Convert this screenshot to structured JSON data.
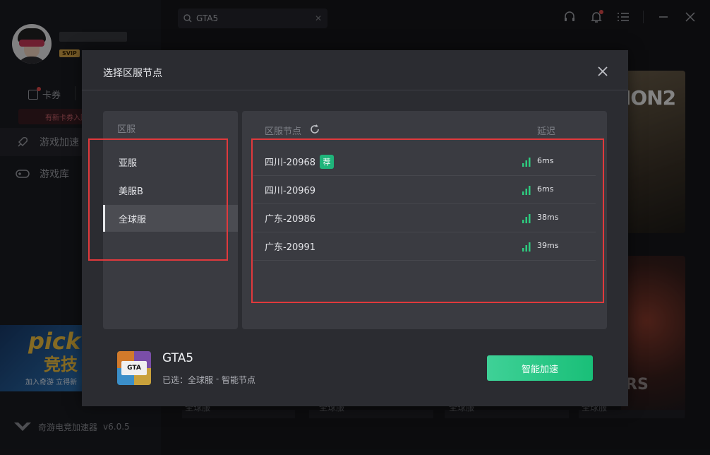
{
  "background": {
    "user": {
      "badge": "SVIP"
    },
    "quick": {
      "coupons_label": "卡券",
      "notice": "有新卡券入账"
    },
    "nav": [
      {
        "label": "游戏加速"
      },
      {
        "label": "游戏库"
      }
    ],
    "banner": {
      "line1": "pick",
      "line2": "竞技",
      "line3": "加入奇游 立得新"
    },
    "brand": {
      "name": "奇游电竞加速器",
      "version": "v6.0.5"
    },
    "search": {
      "value": "GTA5"
    },
    "game_cards": [
      {
        "text": "ION2"
      },
      {
        "text": "RS"
      }
    ],
    "card_region_labels": [
      "全球服",
      "全球服",
      "全球服",
      "全球服"
    ]
  },
  "modal": {
    "title": "选择区服节点",
    "region_header": "区服",
    "regions": [
      {
        "label": "亚服",
        "selected": false
      },
      {
        "label": "美服B",
        "selected": false
      },
      {
        "label": "全球服",
        "selected": true
      }
    ],
    "node_header": "区服节点",
    "latency_header": "延迟",
    "nodes": [
      {
        "name": "四川-20968",
        "recommended": true,
        "badge": "荐",
        "latency": "6ms"
      },
      {
        "name": "四川-20969",
        "recommended": false,
        "latency": "6ms"
      },
      {
        "name": "广东-20986",
        "recommended": false,
        "latency": "38ms"
      },
      {
        "name": "广东-20991",
        "recommended": false,
        "latency": "39ms"
      }
    ],
    "game": {
      "name": "GTA5",
      "icon_text": "GTA",
      "selected_prefix": "已选：",
      "selected_region": "全球服",
      "selected_sep": " - ",
      "selected_node": "智能节点"
    },
    "action_button": "智能加速"
  },
  "colors": {
    "accent_green": "#1fb47a",
    "highlight_red": "#e0393c",
    "signal_green": "#2ecb7f"
  }
}
